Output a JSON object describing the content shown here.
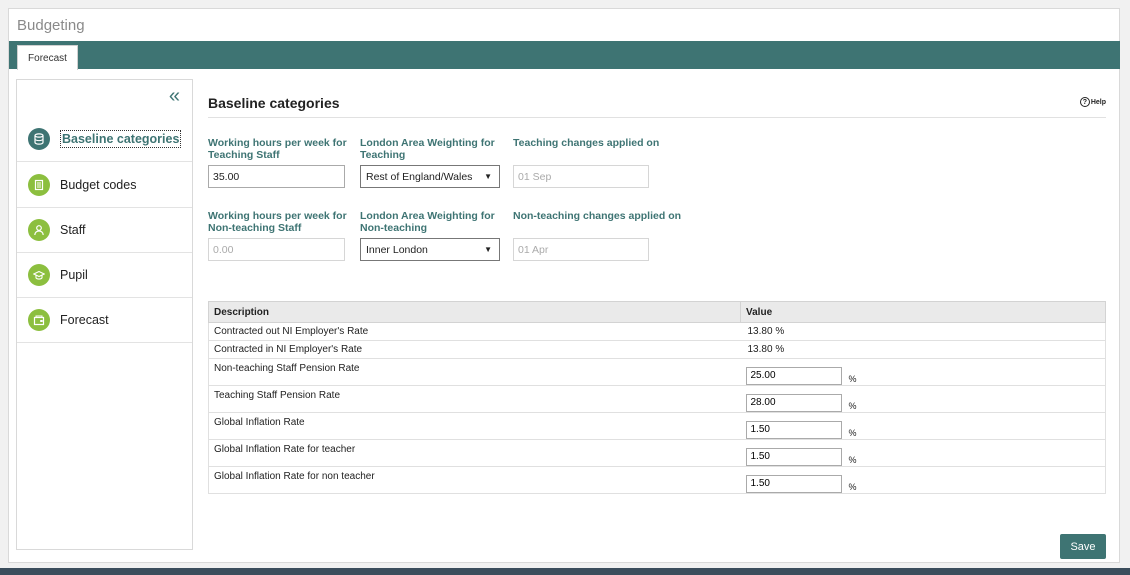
{
  "app": {
    "title": "Budgeting"
  },
  "tabs": [
    {
      "label": "Forecast"
    }
  ],
  "sidebar": {
    "items": [
      {
        "label": "Baseline categories",
        "icon": "database-icon",
        "active": true
      },
      {
        "label": "Budget codes",
        "icon": "document-icon"
      },
      {
        "label": "Staff",
        "icon": "person-icon"
      },
      {
        "label": "Pupil",
        "icon": "graduation-cap-icon"
      },
      {
        "label": "Forecast",
        "icon": "wallet-icon"
      }
    ]
  },
  "main": {
    "title": "Baseline categories",
    "help_label": "Help",
    "fields": {
      "teaching_hours_label_1": "Working hours per week for",
      "teaching_hours_label_2": "Teaching Staff",
      "teaching_hours_value": "35.00",
      "law_teaching_label_1": "London Area Weighting for",
      "law_teaching_label_2": "Teaching",
      "law_teaching_value": "Rest of England/Wales",
      "teaching_changes_label": "Teaching changes applied on",
      "teaching_changes_value": "01 Sep",
      "nonteaching_hours_label_1": "Working hours per week for",
      "nonteaching_hours_label_2": "Non-teaching Staff",
      "nonteaching_hours_value": "0.00",
      "law_nonteaching_label_1": "London Area Weighting for",
      "law_nonteaching_label_2": "Non-teaching",
      "law_nonteaching_value": "Inner London",
      "nonteaching_changes_label": "Non-teaching changes applied on",
      "nonteaching_changes_value": "01 Apr"
    },
    "table": {
      "headers": [
        "Description",
        "Value"
      ],
      "unit": "%",
      "rows": [
        {
          "description": "Contracted out NI Employer's Rate",
          "value": "13.80"
        },
        {
          "description": "Contracted in NI Employer's Rate",
          "value": "13.80"
        },
        {
          "description": "Non-teaching Staff Pension Rate",
          "value": "25.00"
        },
        {
          "description": "Teaching Staff Pension Rate",
          "value": "28.00"
        },
        {
          "description": "Global Inflation Rate",
          "value": "1.50"
        },
        {
          "description": "Global Inflation Rate for teacher",
          "value": "1.50"
        },
        {
          "description": "Global Inflation Rate for non teacher",
          "value": "1.50"
        }
      ]
    },
    "save_label": "Save"
  },
  "colors": {
    "accent": "#3e7473",
    "icon_green": "#8cbf3f"
  }
}
